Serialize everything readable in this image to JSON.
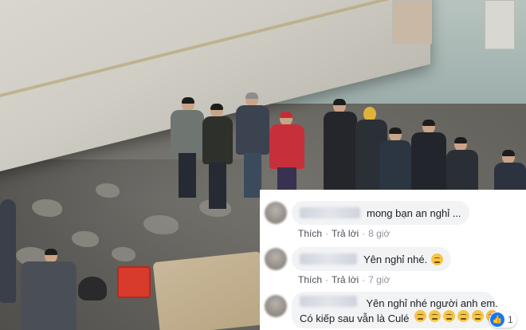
{
  "comments": [
    {
      "text": "mong bạn an nghỉ ...",
      "actions": {
        "like": "Thích",
        "reply": "Trả lời",
        "time": "8 giờ"
      }
    },
    {
      "text": "Yên nghỉ nhé.",
      "emoji": "relieved-face",
      "actions": {
        "like": "Thích",
        "reply": "Trả lời",
        "time": "7 giờ"
      }
    },
    {
      "line1": "Yên nghỉ nhé người anh em.",
      "line2": "Có kiếp sau vẫn là Culé",
      "emojis": [
        "pensive-face",
        "sad-face",
        "relieved-face",
        "relieved-face",
        "worried-face",
        "crying-face"
      ],
      "reaction": {
        "icon": "like-icon",
        "count": "1"
      }
    }
  ],
  "colors": {
    "facebook_blue": "#1877f2",
    "bubble_bg": "#f2f3f5",
    "meta_gray": "#90949c"
  }
}
